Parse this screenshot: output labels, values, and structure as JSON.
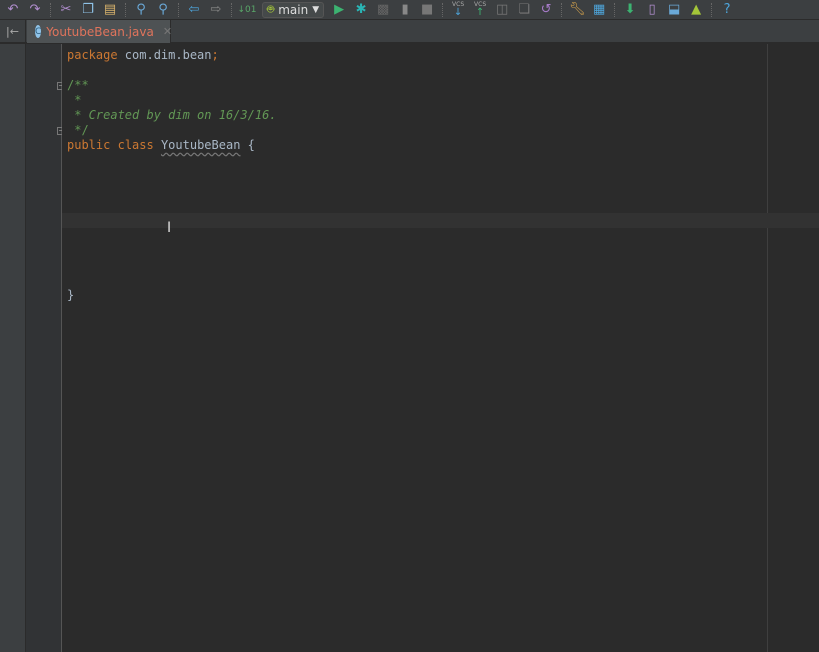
{
  "toolbar": {
    "run_config": "main",
    "icons": [
      "undo-icon",
      "redo-icon",
      "cut-icon",
      "copy-icon",
      "paste-icon",
      "find-icon",
      "replace-icon",
      "back-icon",
      "forward-icon",
      "make-icon",
      "run-icon",
      "debug-icon",
      "coverage-icon",
      "attach-debugger-icon",
      "stop-icon",
      "vcs-update-icon",
      "vcs-commit-icon",
      "compare-icon",
      "history-icon",
      "revert-icon",
      "settings-icon",
      "project-structure-icon",
      "sync-gradle-icon",
      "avd-manager-icon",
      "sdk-manager-icon",
      "android-monitor-icon",
      "help-icon"
    ],
    "vcs_label": "VCS"
  },
  "tab": {
    "label": "YoutubeBean.java",
    "icon_letter": "C"
  },
  "code": {
    "line1_kw": "package",
    "line1_rest": " com.dim.bean",
    "line1_semi": ";",
    "c1": "/**",
    "c2": " *",
    "c3": " * Created by dim on 16/3/16.",
    "c4": " */",
    "kw_public": "public",
    "kw_class": "class",
    "class_name": "YoutubeBean",
    "brace_open": " {",
    "brace_close": "}"
  }
}
